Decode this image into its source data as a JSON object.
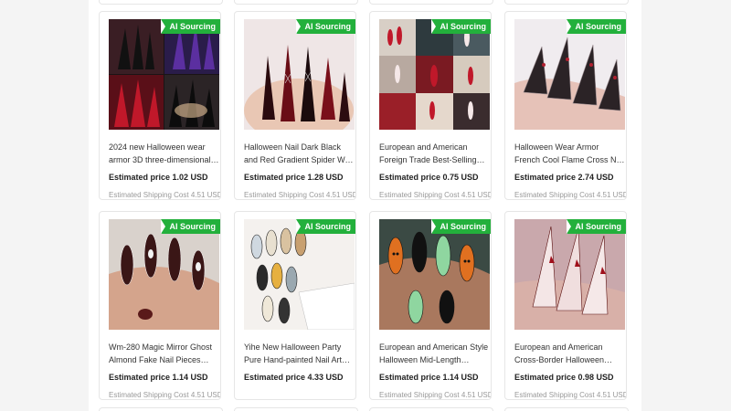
{
  "products": [
    {
      "badge": "AI Sourcing",
      "title": "2024 new Halloween wear armor 3D three-dimensional…",
      "price": "Estimated price 1.02 USD",
      "shipping": "Estimated Shipping Cost 4.51 USD",
      "image": "halloween-nail-collage"
    },
    {
      "badge": "AI Sourcing",
      "title": "Halloween Nail Dark Black and Red Gradient Spider W…",
      "price": "Estimated price 1.28 USD",
      "shipping": "Estimated Shipping Cost 4.51 USD",
      "image": "red-black-gradient-nails"
    },
    {
      "badge": "AI Sourcing",
      "title": "European and American Foreign Trade Best-Selling…",
      "price": "Estimated price 0.75 USD",
      "shipping": "Estimated Shipping Cost 4.51 USD",
      "image": "nail-photo-grid"
    },
    {
      "badge": "AI Sourcing",
      "title": "Halloween Wear Armor French Cool Flame Cross N…",
      "price": "Estimated price 2.74 USD",
      "shipping": "Estimated Shipping Cost 4.51 USD",
      "image": "french-flame-cross-nails"
    },
    {
      "badge": "AI Sourcing",
      "title": "Wm-280 Magic Mirror Ghost Almond Fake Nail Pieces…",
      "price": "Estimated price 1.14 USD",
      "shipping": "Estimated Shipping Cost 4.51 USD",
      "image": "ghost-almond-nails"
    },
    {
      "badge": "AI Sourcing",
      "title": "Yihe New Halloween Party Pure Hand-painted Nail Art…",
      "price": "Estimated price 4.33 USD",
      "shipping": "",
      "image": "hand-painted-nail-set"
    },
    {
      "badge": "AI Sourcing",
      "title": "European and American Style Halloween Mid-Length…",
      "price": "Estimated price 1.14 USD",
      "shipping": "Estimated Shipping Cost 4.51 USD",
      "image": "pumpkin-green-nails"
    },
    {
      "badge": "AI Sourcing",
      "title": "European and American Cross-Border Halloween…",
      "price": "Estimated price 0.98 USD",
      "shipping": "Estimated Shipping Cost 4.51 USD",
      "image": "long-stiletto-red-nails"
    }
  ]
}
